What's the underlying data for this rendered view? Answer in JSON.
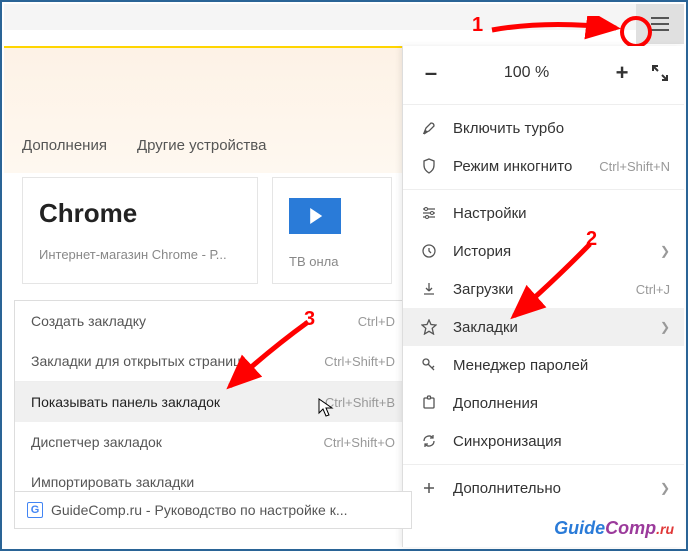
{
  "tabs": {
    "addons": "Дополнения",
    "devices": "Другие устройства"
  },
  "tiles": {
    "chrome": {
      "title": "Chrome",
      "sub": "Интернет-магазин Chrome - Р..."
    },
    "tv": {
      "title": "ТВ онла"
    }
  },
  "submenu": {
    "create": {
      "label": "Создать закладку",
      "sc": "Ctrl+D"
    },
    "openTabs": {
      "label": "Закладки для открытых страниц",
      "sc": "Ctrl+Shift+D"
    },
    "showBar": {
      "label": "Показывать панель закладок",
      "sc": "Ctrl+Shift+B"
    },
    "manager": {
      "label": "Диспетчер закладок",
      "sc": "Ctrl+Shift+O"
    },
    "import": {
      "label": "Импортировать закладки"
    }
  },
  "menu": {
    "zoom": {
      "minus": "–",
      "value": "100 %",
      "plus": "+"
    },
    "turbo": "Включить турбо",
    "incognito": {
      "label": "Режим инкогнито",
      "sc": "Ctrl+Shift+N"
    },
    "settings": "Настройки",
    "history": "История",
    "downloads": {
      "label": "Загрузки",
      "sc": "Ctrl+J"
    },
    "bookmarks": "Закладки",
    "passwords": "Менеджер паролей",
    "addons": "Дополнения",
    "sync": "Синхронизация",
    "more": "Дополнительно"
  },
  "status": "GuideComp.ru - Руководство по настройке к...",
  "annotations": {
    "n1": "1",
    "n2": "2",
    "n3": "3"
  },
  "watermark": {
    "a": "Guide",
    "b": "Comp",
    "c": ".ru"
  }
}
